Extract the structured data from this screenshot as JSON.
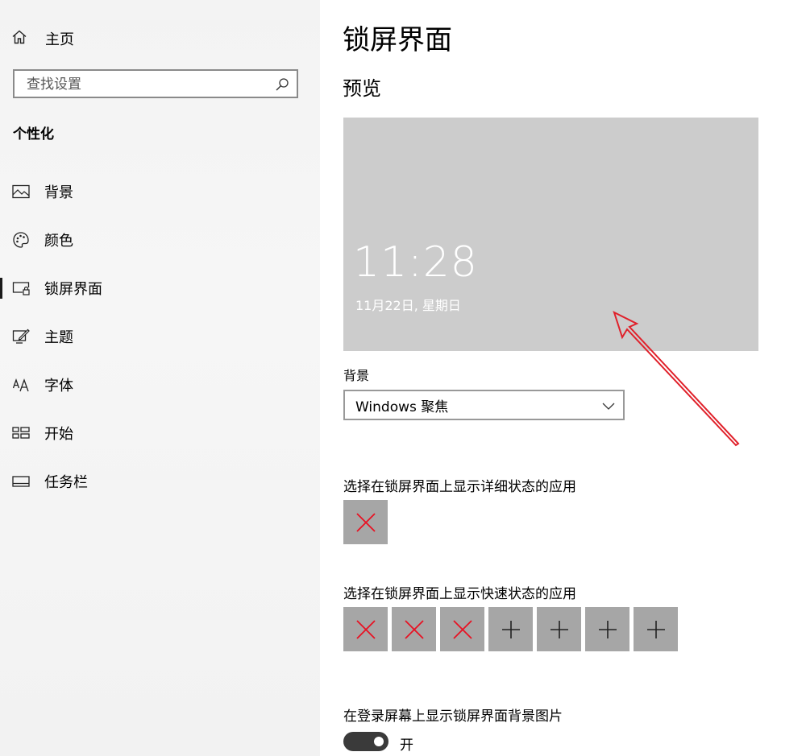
{
  "sidebar": {
    "home_label": "主页",
    "search_placeholder": "查找设置",
    "section_title": "个性化",
    "items": [
      {
        "label": "背景",
        "icon": "picture-icon"
      },
      {
        "label": "颜色",
        "icon": "palette-icon"
      },
      {
        "label": "锁屏界面",
        "icon": "lock-screen-icon",
        "active": true
      },
      {
        "label": "主题",
        "icon": "theme-icon"
      },
      {
        "label": "字体",
        "icon": "font-icon"
      },
      {
        "label": "开始",
        "icon": "start-icon"
      },
      {
        "label": "任务栏",
        "icon": "taskbar-icon"
      }
    ]
  },
  "main": {
    "title": "锁屏界面",
    "preview_heading": "预览",
    "preview": {
      "time": "11:28",
      "date": "11月22日, 星期日"
    },
    "background_label": "背景",
    "background_value": "Windows 聚焦",
    "detailed_status_label": "选择在锁屏界面上显示详细状态的应用",
    "quick_status_label": "选择在锁屏界面上显示快速状态的应用",
    "signin_bg_label": "在登录屏幕上显示锁屏界面背景图片",
    "toggle_state": "开"
  },
  "colors": {
    "preview_bg": "#cccccc",
    "slot_bg": "#a6a6a6",
    "x_mark": "#e81123",
    "annotation_arrow": "#e0202a"
  }
}
